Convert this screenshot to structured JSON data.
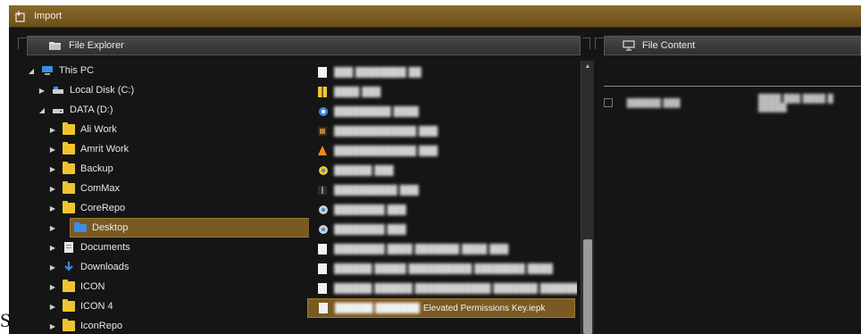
{
  "window": {
    "title": "Import"
  },
  "file_explorer": {
    "header": "File Explorer",
    "tree": [
      {
        "label": "This PC",
        "icon": "computer-icon",
        "expanded": true,
        "level": 0
      },
      {
        "label": "Local Disk (C:)",
        "icon": "drive-icon",
        "expanded": false,
        "level": 1
      },
      {
        "label": "DATA (D:)",
        "icon": "drive-icon",
        "expanded": true,
        "level": 1
      },
      {
        "label": "Ali Work",
        "icon": "folder-icon",
        "level": 2
      },
      {
        "label": "Amrit Work",
        "icon": "folder-icon",
        "level": 2
      },
      {
        "label": "Backup",
        "icon": "folder-icon",
        "level": 2
      },
      {
        "label": "ComMax",
        "icon": "folder-icon",
        "level": 2
      },
      {
        "label": "CoreRepo",
        "icon": "folder-icon",
        "level": 2
      },
      {
        "label": "Desktop",
        "icon": "desktop-folder-icon",
        "level": 2,
        "selected": true
      },
      {
        "label": "Documents",
        "icon": "documents-icon",
        "level": 2
      },
      {
        "label": "Downloads",
        "icon": "download-icon",
        "level": 2
      },
      {
        "label": "ICON",
        "icon": "folder-icon",
        "level": 2
      },
      {
        "label": "ICON 4",
        "icon": "folder-icon",
        "level": 2
      },
      {
        "label": "IconRepo",
        "icon": "folder-icon",
        "level": 2
      }
    ],
    "files": [
      {
        "name": "",
        "icon": "file-icon",
        "blurred": true
      },
      {
        "name": "",
        "icon": "zip-icon",
        "blurred": true
      },
      {
        "name": "",
        "icon": "word-doc-icon",
        "blurred": true
      },
      {
        "name": "",
        "icon": "installer-icon",
        "blurred": true
      },
      {
        "name": "",
        "icon": "vlc-icon",
        "blurred": true
      },
      {
        "name": "",
        "icon": "shortcut-icon",
        "blurred": true
      },
      {
        "name": "",
        "icon": "exe-icon",
        "blurred": true
      },
      {
        "name": "",
        "icon": "setup-icon",
        "blurred": true
      },
      {
        "name": "",
        "icon": "setup-icon",
        "blurred": true
      },
      {
        "name": "",
        "icon": "file-icon",
        "blurred": true
      },
      {
        "name": "",
        "icon": "file-icon",
        "blurred": true
      },
      {
        "name": "",
        "icon": "file-icon",
        "blurred": true
      },
      {
        "name": "Elevated Permissions Key.iepk",
        "icon": "file-icon",
        "blurred": false,
        "selected": true
      }
    ]
  },
  "file_content": {
    "header": "File Content"
  },
  "stray_text": "S",
  "colors": {
    "accent": "#7a5a22",
    "titlebar": "#6b4f1c",
    "background": "#151515",
    "folder": "#f0c430"
  }
}
